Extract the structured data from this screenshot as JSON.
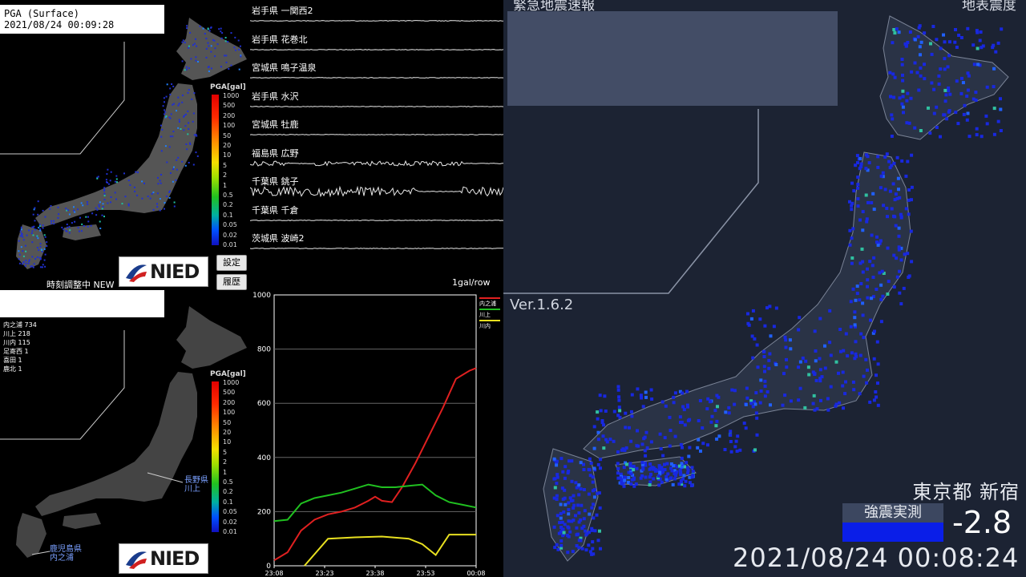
{
  "kyoshin": {
    "top_map": {
      "header_line1": "PGA (Surface)",
      "header_line2": "2021/08/24 00:09:28",
      "scale_title": "PGA[gal]",
      "scale_ticks": [
        "1000",
        "500",
        "200",
        "100",
        "50",
        "20",
        "10",
        "5",
        "2",
        "1",
        "0.5",
        "0.2",
        "0.1",
        "0.05",
        "0.02",
        "0.01"
      ],
      "status": "時刻調整中 NEW",
      "logo": "NIED"
    },
    "bottom_map": {
      "stations": [
        "内之浦 734",
        "川上 218",
        "川内 115",
        "足寄西 1",
        "喜田 1",
        "鹿北 1"
      ],
      "scale_title": "PGA[gal]",
      "scale_ticks": [
        "1000",
        "500",
        "200",
        "100",
        "50",
        "20",
        "10",
        "5",
        "2",
        "1",
        "0.5",
        "0.2",
        "0.1",
        "0.05",
        "0.02",
        "0.01"
      ],
      "callout_1_line1": "長野県",
      "callout_1_line2": "川上",
      "callout_2_line1": "鹿児島県",
      "callout_2_line2": "内之浦",
      "logo": "NIED"
    },
    "buttons": {
      "settings": "設定",
      "history": "履歴"
    },
    "waveforms": [
      {
        "label": "岩手県 一関西2",
        "activity": 0
      },
      {
        "label": "岩手県 花巻北",
        "activity": 0
      },
      {
        "label": "宮城県 鳴子温泉",
        "activity": 0
      },
      {
        "label": "岩手県 水沢",
        "activity": 0
      },
      {
        "label": "宮城県 牡鹿",
        "activity": 0
      },
      {
        "label": "福島県 広野",
        "activity": 1
      },
      {
        "label": "千葉県 銚子",
        "activity": 2
      },
      {
        "label": "千葉県 千倉",
        "activity": 0
      },
      {
        "label": "茨城県 波崎2",
        "activity": 0
      }
    ],
    "wave_scale": "1gal/row"
  },
  "chart_data": {
    "type": "line",
    "x": [
      "23:08",
      "23:23",
      "23:38",
      "23:53",
      "00:08"
    ],
    "ylim": [
      0,
      1000
    ],
    "yticks": [
      0,
      200,
      400,
      600,
      800,
      1000
    ],
    "series": [
      {
        "name": "内之浦",
        "color": "#e02020",
        "values": [
          [
            0,
            20
          ],
          [
            4,
            50
          ],
          [
            8,
            130
          ],
          [
            12,
            170
          ],
          [
            16,
            190
          ],
          [
            20,
            200
          ],
          [
            24,
            215
          ],
          [
            28,
            240
          ],
          [
            30,
            255
          ],
          [
            32,
            240
          ],
          [
            35,
            235
          ],
          [
            38,
            290
          ],
          [
            42,
            380
          ],
          [
            46,
            480
          ],
          [
            50,
            580
          ],
          [
            54,
            690
          ],
          [
            58,
            720
          ],
          [
            60,
            730
          ]
        ]
      },
      {
        "name": "川上",
        "color": "#20c020",
        "values": [
          [
            0,
            165
          ],
          [
            4,
            170
          ],
          [
            8,
            230
          ],
          [
            12,
            250
          ],
          [
            16,
            260
          ],
          [
            20,
            270
          ],
          [
            24,
            285
          ],
          [
            28,
            300
          ],
          [
            32,
            290
          ],
          [
            36,
            290
          ],
          [
            40,
            295
          ],
          [
            44,
            300
          ],
          [
            48,
            260
          ],
          [
            52,
            235
          ],
          [
            56,
            225
          ],
          [
            60,
            215
          ]
        ]
      },
      {
        "name": "川内",
        "color": "#e8e020",
        "values": [
          [
            9,
            0
          ],
          [
            16,
            100
          ],
          [
            24,
            105
          ],
          [
            32,
            108
          ],
          [
            40,
            100
          ],
          [
            44,
            80
          ],
          [
            48,
            40
          ],
          [
            52,
            115
          ],
          [
            60,
            115
          ]
        ]
      }
    ]
  },
  "eew": {
    "title_left": "緊急地震速報",
    "title_right": "地表震度",
    "version": "Ver.1.6.2",
    "place": "東京都 新宿",
    "measure_label": "強震実測",
    "measure_value": "-2.8",
    "measure_color": "#0a1ee8",
    "timestamp": "2021/08/24  00:08:24"
  }
}
